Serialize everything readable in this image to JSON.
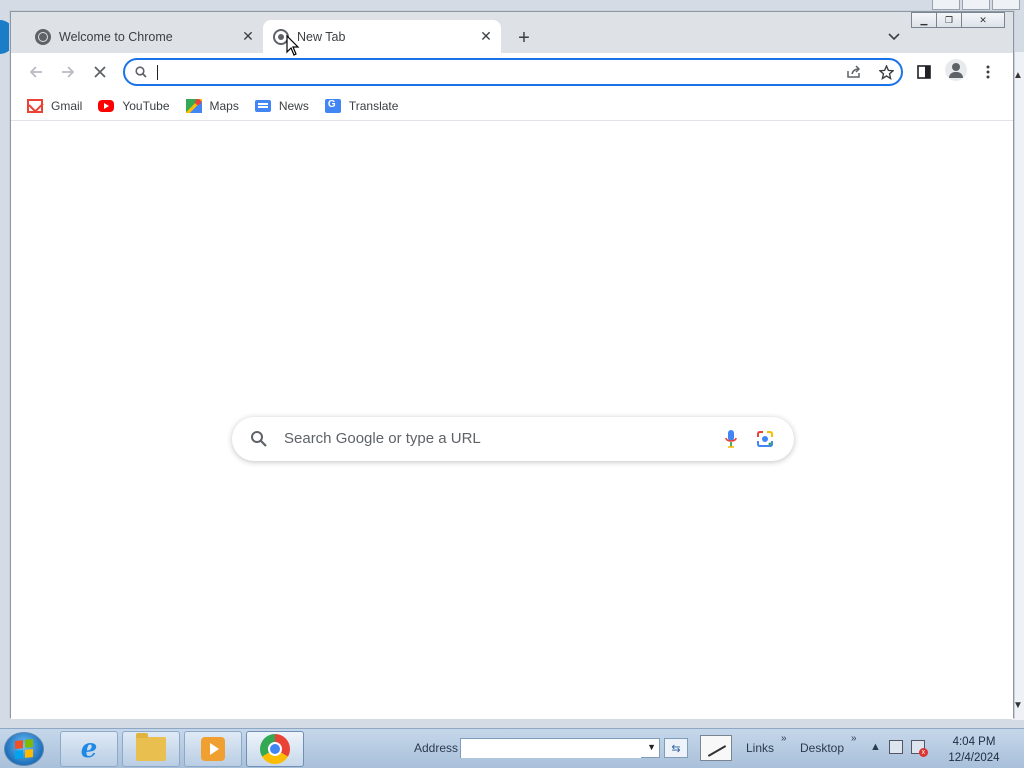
{
  "tabs": [
    {
      "title": "Welcome to Chrome",
      "active": false
    },
    {
      "title": "New Tab",
      "active": true
    }
  ],
  "toolbar": {
    "omnibox_value": "",
    "icons": [
      "back-icon",
      "forward-icon",
      "stop-icon",
      "share-icon",
      "star-icon",
      "side-panel-icon",
      "profile-icon",
      "menu-icon"
    ]
  },
  "bookmarks": [
    {
      "label": "Gmail",
      "icon": "gmail-icon"
    },
    {
      "label": "YouTube",
      "icon": "youtube-icon"
    },
    {
      "label": "Maps",
      "icon": "maps-icon"
    },
    {
      "label": "News",
      "icon": "news-icon"
    },
    {
      "label": "Translate",
      "icon": "translate-icon"
    }
  ],
  "newtab": {
    "search_placeholder": "Search Google or type a URL"
  },
  "taskbar": {
    "address_label": "Address",
    "address_value": "",
    "links_label": "Links",
    "desktop_label": "Desktop",
    "time": "4:04 PM",
    "date": "12/4/2024"
  },
  "colors": {
    "accent": "#1a73e8",
    "tabstrip": "#dee1e6",
    "taskbar": "#b9cde3"
  }
}
